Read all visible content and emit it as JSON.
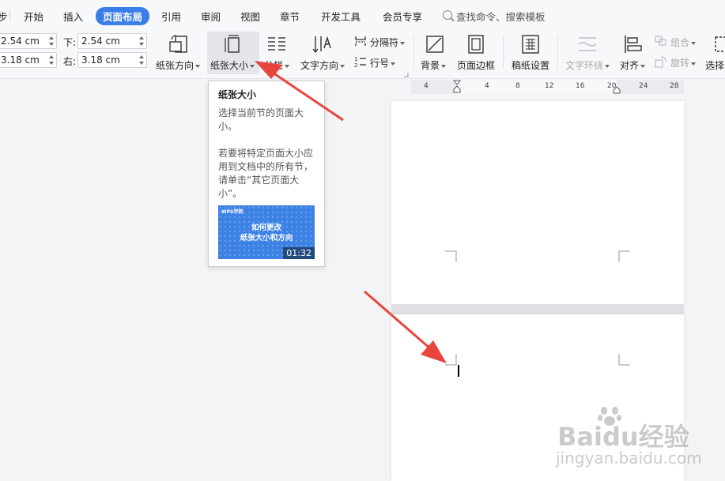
{
  "menu": {
    "partial": "步",
    "items": [
      "开始",
      "插入",
      "页面布局",
      "引用",
      "审阅",
      "视图",
      "章节",
      "开发工具",
      "会员专享"
    ],
    "active_index": 2,
    "search_placeholder": "查找命令、搜索模板"
  },
  "margins": {
    "top_value": "2.54 cm",
    "left_value": "3.18 cm",
    "bottom_label": "下:",
    "bottom_value": "2.54 cm",
    "right_label": "右:",
    "right_value": "3.18 cm"
  },
  "ribbon": {
    "orientation": "纸张方向",
    "paper_size": "纸张大小",
    "columns": "分栏",
    "text_direction": "文字方向",
    "separator": "分隔符",
    "line_number": "行号",
    "background": "背景",
    "page_border": "页面边框",
    "manuscript": "稿纸设置",
    "text_wrap": "文字环绕",
    "align": "对齐",
    "group": "组合",
    "rotate": "旋转",
    "select": "选择"
  },
  "ruler_ticks": [
    "4",
    "4",
    "8",
    "12",
    "16",
    "20",
    "24",
    "28"
  ],
  "tooltip": {
    "title": "纸张大小",
    "line1": "选择当前节的页面大小。",
    "line2": "若要将特定页面大小应用到文档中的所有节，请单击“其它页面大小”。",
    "thumb_logo": "WPS学院",
    "thumb_title_1": "如何更改",
    "thumb_title_2": "纸张大小和方向",
    "duration": "01:32"
  },
  "watermark": {
    "brand": "Baidu经验",
    "url": "jingyan.baidu.com"
  },
  "colors": {
    "accent": "#3a7ee8",
    "arrow": "#e8453c"
  }
}
